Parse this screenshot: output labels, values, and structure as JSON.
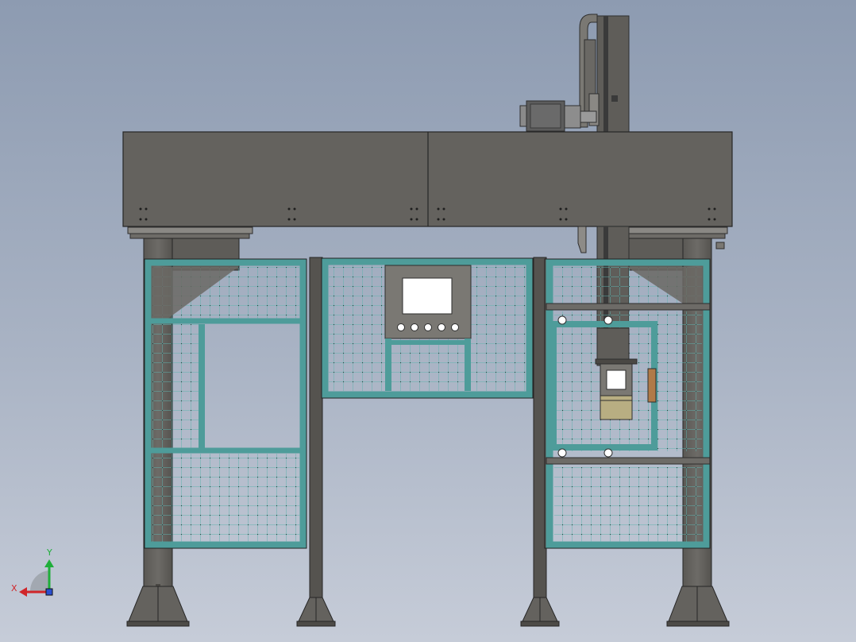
{
  "colors": {
    "background_top": "#8d9bb1",
    "background_bottom": "#c6ccd8",
    "frame_steel": "#64625e",
    "frame_steel_edge": "#2e2e2e",
    "guard_frame": "#4e9c9a",
    "guard_mesh": "#5fb3ae",
    "axis_y": "#1fae3a",
    "axis_x": "#d0262a",
    "axis_z": "#2a4fd0",
    "motor": "#606060",
    "gripper_block": "#b8ae82",
    "handle": "#b07a48"
  },
  "triad": {
    "y_label": "Y",
    "x_label": "X"
  }
}
